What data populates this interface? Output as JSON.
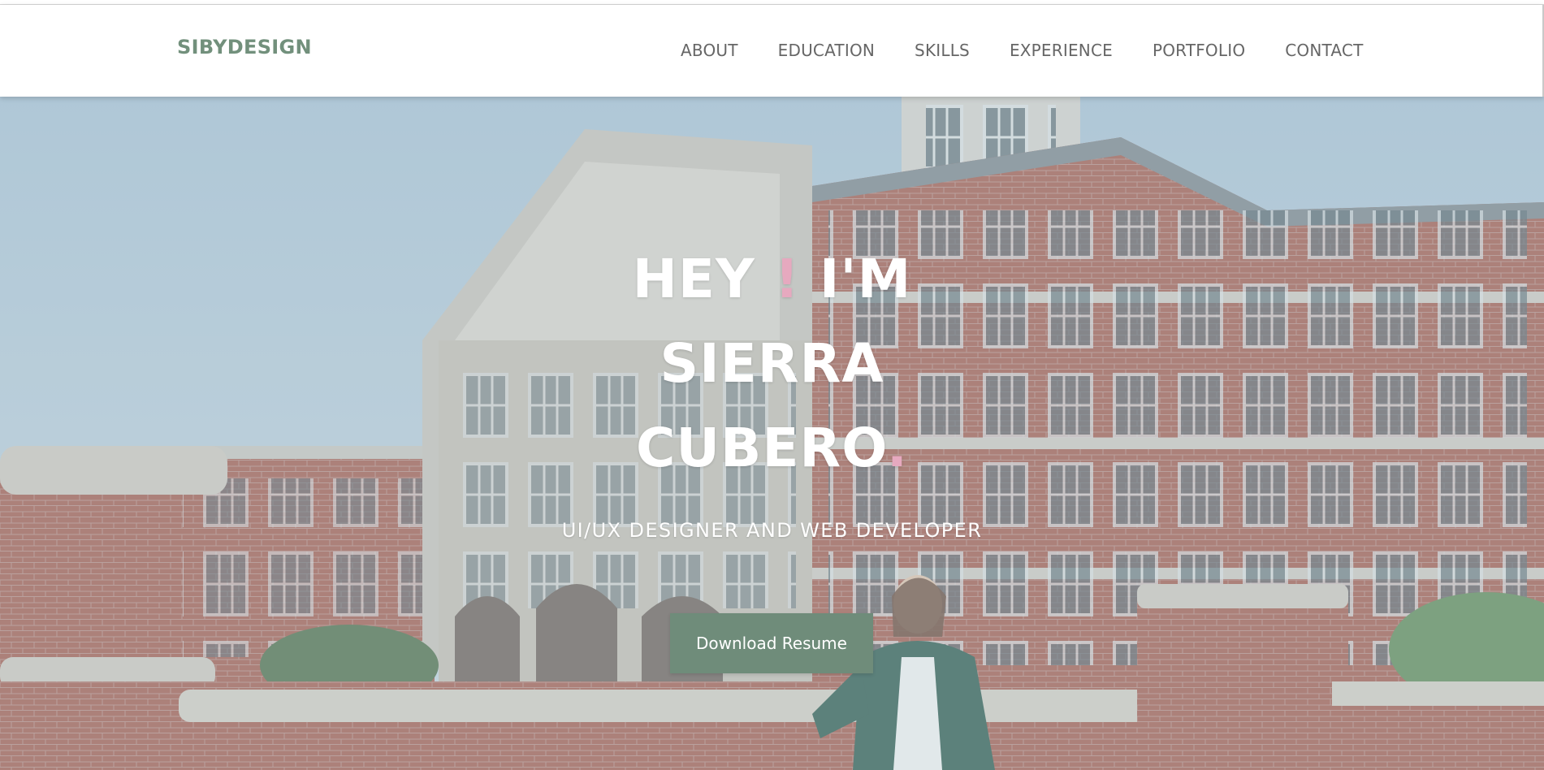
{
  "brand": {
    "name": "SIBYDESIGN",
    "color": "#72907c"
  },
  "nav": {
    "items": [
      {
        "label": "ABOUT"
      },
      {
        "label": "EDUCATION"
      },
      {
        "label": "SKILLS"
      },
      {
        "label": "EXPERIENCE"
      },
      {
        "label": "PORTFOLIO"
      },
      {
        "label": "CONTACT"
      }
    ]
  },
  "hero": {
    "greeting": "HEY",
    "exclaim": "!",
    "im": "I'M",
    "first_name": "SIERRA",
    "last_name": "CUBERO",
    "period": ".",
    "subtitle": "UI/UX DESIGNER AND WEB DEVELOPER",
    "cta_label": "Download Resume",
    "accent_color": "#e6a9bf",
    "button_color": "#6f8c7a"
  }
}
